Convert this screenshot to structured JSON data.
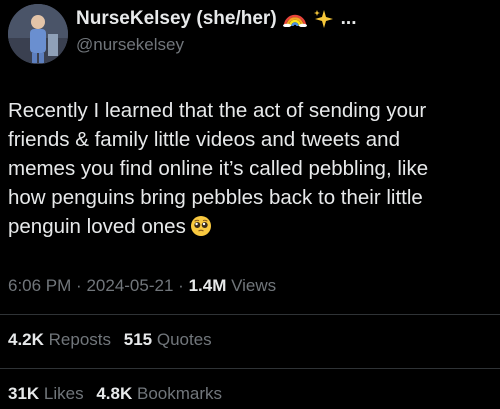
{
  "author": {
    "display_name": "NurseKelsey (she/her)",
    "name_suffix": "...",
    "handle": "@nursekelsey",
    "avatar_icon": "profile-photo"
  },
  "tweet": {
    "lines": [
      "Recently I learned that the act of sending your",
      "friends & family little videos and tweets and",
      "memes you find online it’s called pebbling, like",
      "how penguins bring pebbles back to their little",
      "penguin loved ones"
    ],
    "emoji": "pleading-face"
  },
  "meta": {
    "time": "6:06 PM",
    "separator": "·",
    "date": "2024-05-21",
    "views_count": "1.4M",
    "views_label": "Views"
  },
  "stats": {
    "reposts_count": "4.2K",
    "reposts_label": "Reposts",
    "quotes_count": "515",
    "quotes_label": "Quotes",
    "likes_count": "31K",
    "likes_label": "Likes",
    "bookmarks_count": "4.8K",
    "bookmarks_label": "Bookmarks"
  },
  "colors": {
    "background": "#000000",
    "primary_text": "#e7e9ea",
    "secondary_text": "#71767b",
    "divider": "#2f3336"
  }
}
